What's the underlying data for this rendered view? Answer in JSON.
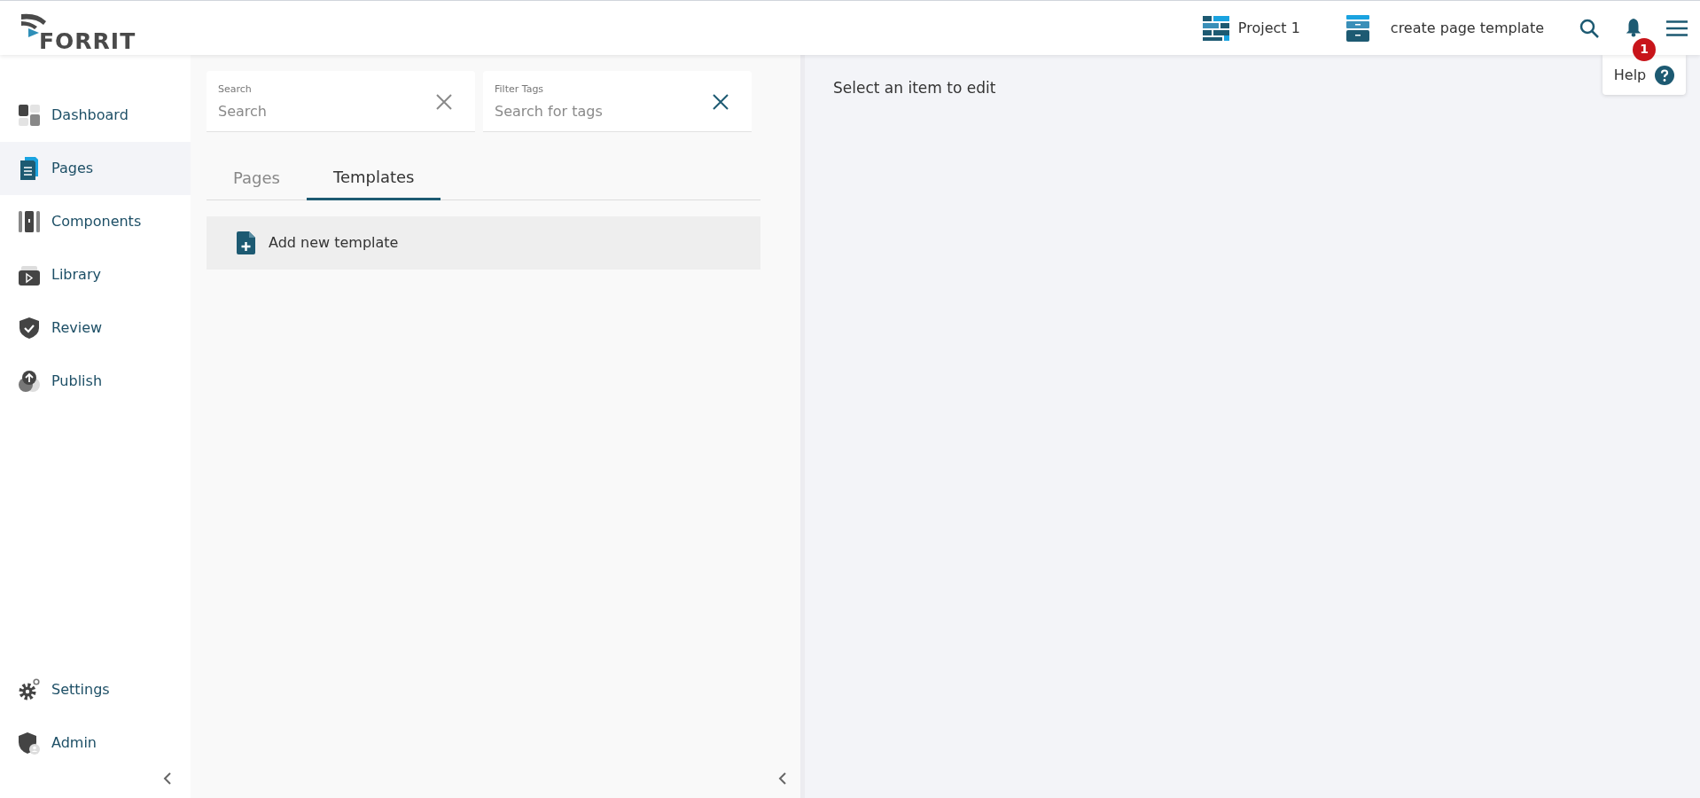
{
  "header": {
    "logo": "FORRIT",
    "project": "Project 1",
    "context": "create page template",
    "notifications": "1",
    "help": "Help"
  },
  "sidebar": {
    "items": [
      {
        "label": "Dashboard",
        "selected": false
      },
      {
        "label": "Pages",
        "selected": true
      },
      {
        "label": "Components",
        "selected": false
      },
      {
        "label": "Library",
        "selected": false
      },
      {
        "label": "Review",
        "selected": false
      },
      {
        "label": "Publish",
        "selected": false
      }
    ],
    "bottom_items": [
      {
        "label": "Settings",
        "selected": false
      },
      {
        "label": "Admin",
        "selected": false
      }
    ]
  },
  "filters": [
    {
      "label": "Search",
      "placeholder": "Search"
    },
    {
      "label": "Filter Tags",
      "placeholder": "Search for tags"
    }
  ],
  "tabs": [
    {
      "label": "Pages",
      "selected": false
    },
    {
      "label": "Templates",
      "selected": true
    }
  ],
  "list": [
    {
      "label": "Add new template"
    }
  ],
  "editor": {
    "message": "Select an item to edit"
  }
}
